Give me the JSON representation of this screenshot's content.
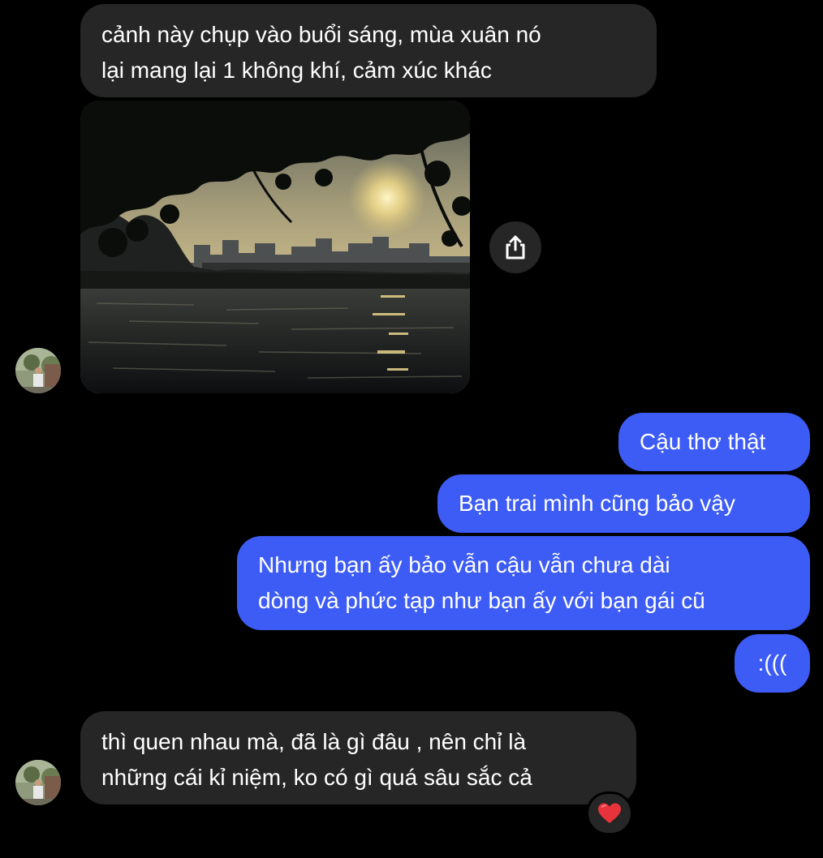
{
  "colors": {
    "background": "#000000",
    "incoming_bubble": "#262626",
    "outgoing_bubble": "#3d5cf5",
    "text": "#ffffff"
  },
  "thread": {
    "msg1": {
      "line1": "cảnh này chụp vào buổi sáng, mùa xuân nó",
      "line2": "lại mang lại 1 không khí, cảm xúc khác"
    },
    "photo": {
      "icon": "share-icon"
    },
    "msg2": {
      "text": "Cậu thơ thật"
    },
    "msg3": {
      "text": "Bạn trai mình cũng bảo vậy"
    },
    "msg4": {
      "line1": "Nhưng bạn ấy bảo vẫn cậu vẫn chưa dài",
      "line2": "dòng và phức tạp như bạn ấy với bạn gái cũ"
    },
    "msg5": {
      "text": ":((("
    },
    "msg6": {
      "line1": "thì quen nhau mà, đã là gì đâu , nên chỉ là",
      "line2": "những cái kỉ niệm, ko có gì quá sâu sắc cả"
    },
    "reaction": {
      "emoji": "❤️",
      "icon": "heart-icon"
    }
  }
}
